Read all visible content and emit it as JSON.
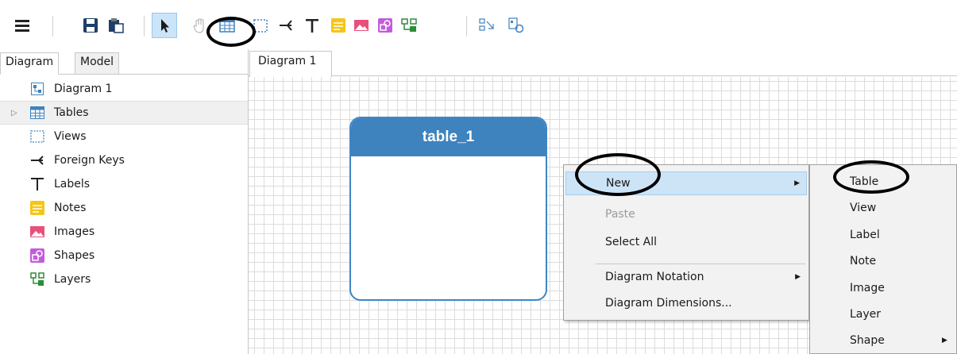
{
  "left_panel": {
    "tabs": [
      "Diagram",
      "Model"
    ],
    "tree": [
      {
        "label": "Diagram 1",
        "icon": "diagram-icon"
      },
      {
        "label": "Tables",
        "icon": "table-icon",
        "expandable": true,
        "selected": true
      },
      {
        "label": "Views",
        "icon": "view-icon"
      },
      {
        "label": "Foreign Keys",
        "icon": "foreign-key-icon"
      },
      {
        "label": "Labels",
        "icon": "label-icon"
      },
      {
        "label": "Notes",
        "icon": "note-icon"
      },
      {
        "label": "Images",
        "icon": "image-icon"
      },
      {
        "label": "Shapes",
        "icon": "shape-icon"
      },
      {
        "label": "Layers",
        "icon": "layer-icon"
      }
    ]
  },
  "diagram": {
    "tab_label": "Diagram 1",
    "table_name": "table_1"
  },
  "context_menu": {
    "items": [
      {
        "label": "New",
        "has_submenu": true,
        "highlighted": true
      },
      {
        "label": "Paste",
        "disabled": true
      },
      {
        "label": "Select All"
      },
      {
        "label": "Diagram Notation",
        "has_submenu": true
      },
      {
        "label": "Diagram Dimensions..."
      }
    ]
  },
  "submenu": {
    "items": [
      {
        "label": "Table"
      },
      {
        "label": "View"
      },
      {
        "label": "Label"
      },
      {
        "label": "Note"
      },
      {
        "label": "Image"
      },
      {
        "label": "Layer"
      },
      {
        "label": "Shape",
        "has_submenu": true
      }
    ]
  },
  "toolbar": {
    "icons": [
      "menu-icon",
      "save-icon",
      "paste-icon",
      "select-tool-icon",
      "pan-tool-icon",
      "new-table-icon",
      "new-view-icon",
      "foreign-key-tool-icon",
      "label-tool-icon",
      "note-tool-icon",
      "image-tool-icon",
      "shape-tool-icon",
      "layer-tool-icon",
      "arrange-icon",
      "diagram-properties-icon"
    ]
  },
  "colors": {
    "accent": "#3e82be",
    "highlight": "#cde4f7",
    "note_yellow": "#f5c518",
    "image_red": "#e8507a",
    "shape_purple": "#c45bdc",
    "layer_green": "#2e8b3a"
  }
}
